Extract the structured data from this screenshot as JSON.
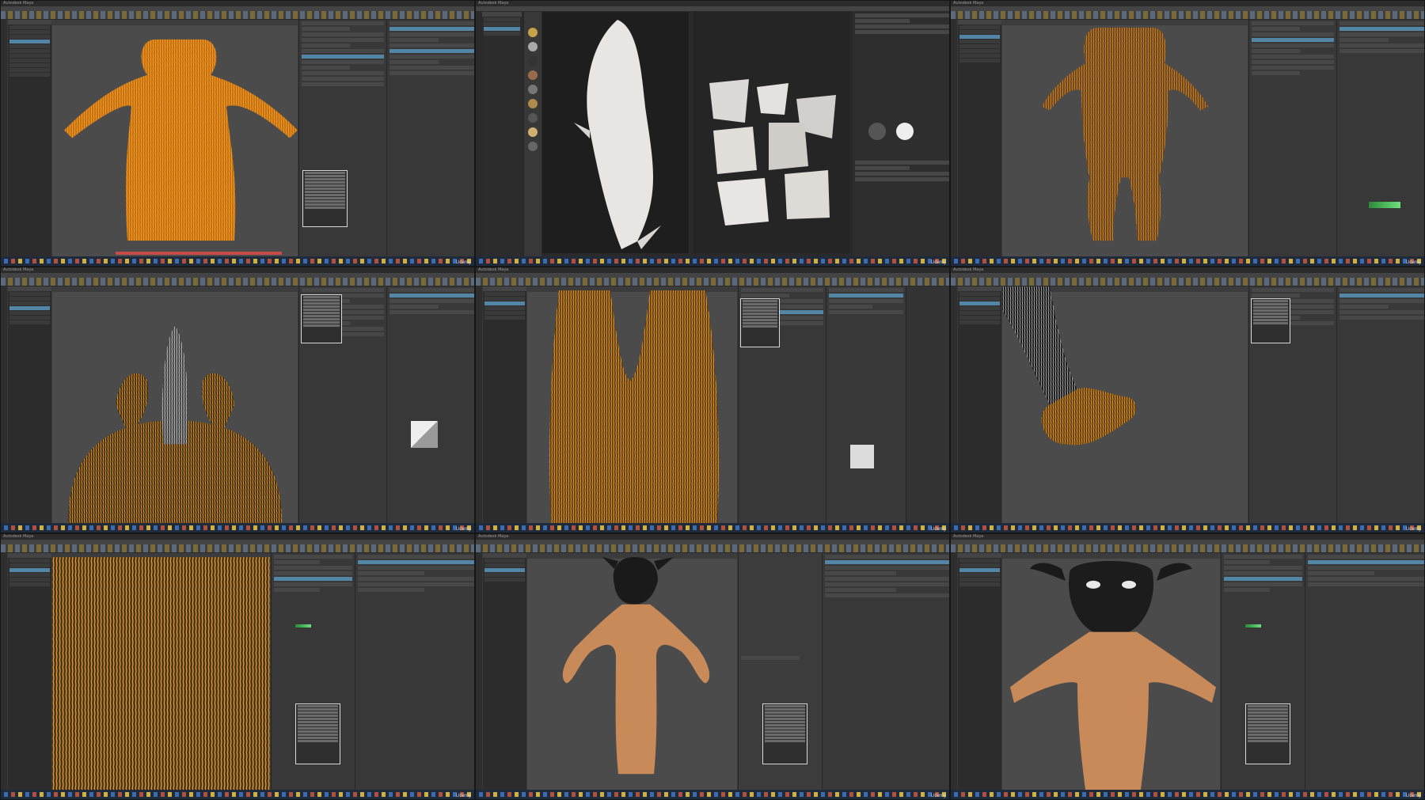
{
  "app": {
    "window_title": "Autodesk Maya",
    "logo_text": "Udemy"
  },
  "tiles": [
    {
      "id": "t1",
      "desc": "maya-fur-body-orange-guides"
    },
    {
      "id": "t2",
      "desc": "substance-uv-layout"
    },
    {
      "id": "t3",
      "desc": "maya-fur-body-front-guides"
    },
    {
      "id": "t4",
      "desc": "maya-fur-head-ears"
    },
    {
      "id": "t5",
      "desc": "maya-fur-legs-closeup"
    },
    {
      "id": "t6",
      "desc": "maya-fur-hand-grooming"
    },
    {
      "id": "t7",
      "desc": "maya-fur-back-closeup"
    },
    {
      "id": "t8",
      "desc": "maya-render-full-body"
    },
    {
      "id": "t9",
      "desc": "maya-render-upper-body"
    }
  ],
  "colors": {
    "fur_orange": "#f0a020",
    "skin_tan": "#c98a5a",
    "selection_blue": "#5285a6",
    "taskbar": "#1f2b3a"
  }
}
